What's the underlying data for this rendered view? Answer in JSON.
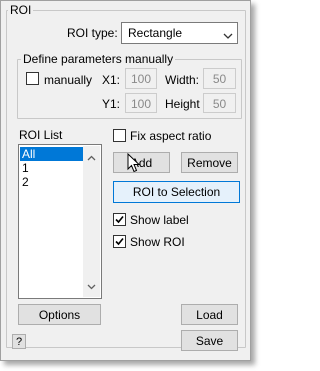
{
  "roi_group": {
    "title": "ROI"
  },
  "roi_type": {
    "label": "ROI type:",
    "value": "Rectangle"
  },
  "manual": {
    "title": "Define parameters manually",
    "checkbox_label": "manually",
    "checked": false,
    "x1_label": "X1:",
    "x1_value": "100",
    "y1_label": "Y1:",
    "y1_value": "100",
    "width_label": "Width:",
    "width_value": "50",
    "height_label": "Height",
    "height_value": "50"
  },
  "roi_list": {
    "label": "ROI List",
    "items": [
      "All",
      "1",
      "2"
    ],
    "selected": "All"
  },
  "fix_aspect": {
    "label": "Fix aspect ratio",
    "checked": false
  },
  "buttons": {
    "add": "Add",
    "remove": "Remove",
    "roi_to_selection": "ROI to Selection",
    "options": "Options",
    "load": "Load",
    "save": "Save",
    "help": "?"
  },
  "show_label": {
    "label": "Show label",
    "checked": true
  },
  "show_roi": {
    "label": "Show ROI",
    "checked": true
  },
  "colors": {
    "accent": "#0078d7",
    "selection": "#0078d7"
  }
}
